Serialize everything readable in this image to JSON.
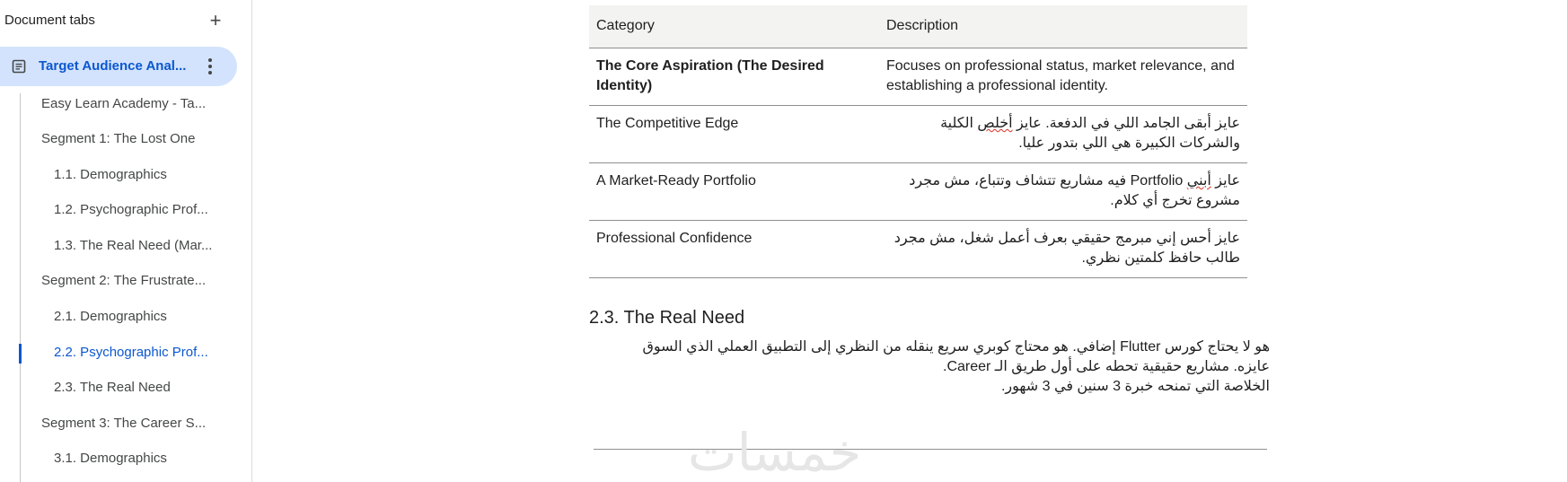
{
  "sidebar": {
    "title": "Document tabs",
    "add_icon": "plus-icon",
    "active_tab": {
      "label": "Target Audience Anal...",
      "icon": "document-icon",
      "more_icon": "more-vert-icon"
    },
    "outline": [
      {
        "label": "Easy Learn Academy - Ta...",
        "level": 1
      },
      {
        "label": "Segment 1: The Lost One",
        "level": 1
      },
      {
        "label": "1.1. Demographics",
        "level": 2
      },
      {
        "label": "1.2. Psychographic Prof...",
        "level": 2
      },
      {
        "label": "1.3. The Real Need (Mar...",
        "level": 2
      },
      {
        "label": "Segment 2: The Frustrate...",
        "level": 1
      },
      {
        "label": "2.1. Demographics",
        "level": 2
      },
      {
        "label": "2.2. Psychographic Prof...",
        "level": 2,
        "active": true
      },
      {
        "label": "2.3. The Real Need",
        "level": 2
      },
      {
        "label": "Segment 3: The Career S...",
        "level": 1
      },
      {
        "label": "3.1. Demographics",
        "level": 2
      }
    ]
  },
  "table": {
    "headers": [
      "Category",
      "Description"
    ],
    "rows": [
      {
        "category": "The Core Aspiration (The Desired Identity)",
        "description": "Focuses on professional status, market relevance, and establishing a professional identity."
      },
      {
        "category": "The Competitive Edge",
        "description_a": "عايز أبقى الجامد اللي في الدفعة. عايز ",
        "description_b": "أخلص",
        "description_c": " الكلية والشركات الكبيرة هي اللي بتدور عليا."
      },
      {
        "category": "A Market-Ready Portfolio",
        "description_a": "عايز ",
        "description_b": "أبني",
        "description_c": " Portfolio فيه مشاريع تتشاف وتتباع، مش مجرد مشروع تخرج أي كلام."
      },
      {
        "category": "Professional Confidence",
        "description": "عايز أحس إني مبرمج حقيقي بعرف أعمل شغل، مش مجرد طالب حافظ كلمتين نظري."
      }
    ]
  },
  "section": {
    "heading": "2.3. The Real Need",
    "lines": [
      "هو لا يحتاج كورس Flutter إضافي. هو محتاج كوبري سريع  ينقله من النظري إلى التطبيق العملي الذي السوق",
      "عايزه. مشاريع حقيقية تحطه على أول طريق الـ Career.",
      "الخلاصة التي تمنحه خبرة 3 سنين في 3 شهور."
    ]
  },
  "watermark": "خمسات",
  "colors": {
    "active_tab_bg": "#d3e3fd",
    "accent": "#0b57d0",
    "table_header_bg": "#f3f3f1"
  }
}
